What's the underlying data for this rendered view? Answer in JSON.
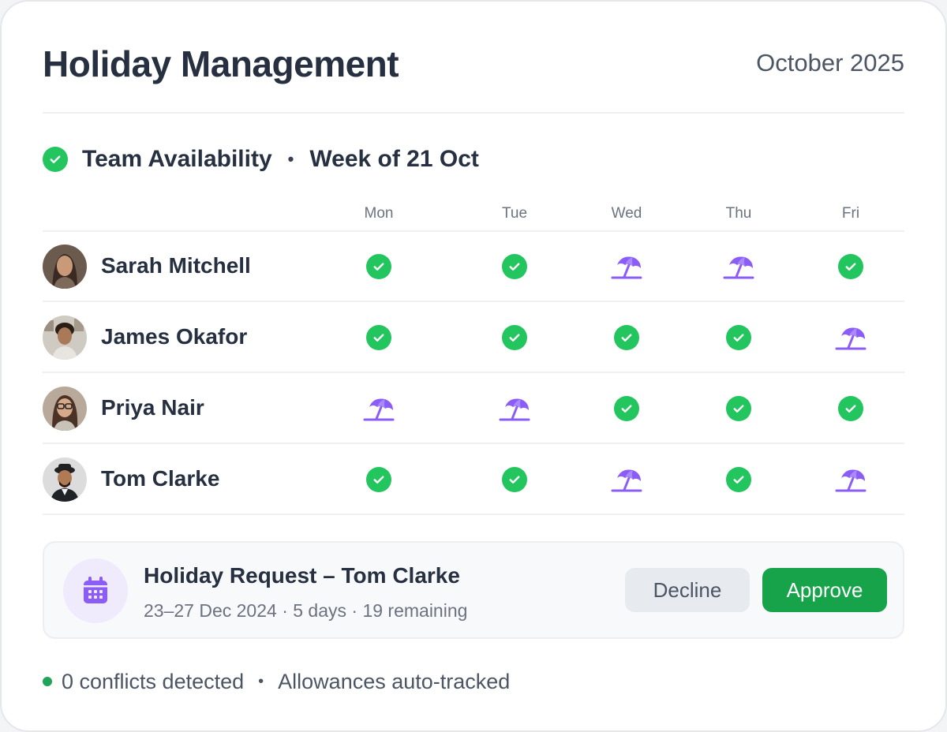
{
  "header": {
    "title": "Holiday Management",
    "month": "October 2025"
  },
  "availability": {
    "heading": "Team Availability",
    "separator": "•",
    "week": "Week of 21 Oct",
    "status_icon": "check-circle-icon",
    "days": [
      "Mon",
      "Tue",
      "Wed",
      "Thu",
      "Fri"
    ],
    "members": [
      {
        "name": "Sarah Mitchell",
        "avatar": "avatar-sarah",
        "days": [
          "available",
          "available",
          "holiday",
          "holiday",
          "available"
        ]
      },
      {
        "name": "James Okafor",
        "avatar": "avatar-james",
        "days": [
          "available",
          "available",
          "available",
          "available",
          "holiday"
        ]
      },
      {
        "name": "Priya Nair",
        "avatar": "avatar-priya",
        "days": [
          "holiday",
          "holiday",
          "available",
          "available",
          "available"
        ]
      },
      {
        "name": "Tom Clarke",
        "avatar": "avatar-tom",
        "days": [
          "available",
          "available",
          "holiday",
          "available",
          "holiday"
        ]
      }
    ]
  },
  "request": {
    "icon": "calendar-icon",
    "title": "Holiday Request – Tom Clarke",
    "details": "23–27 Dec 2024 · 5 days · 19 remaining",
    "decline_label": "Decline",
    "approve_label": "Approve"
  },
  "footer": {
    "conflicts": "0 conflicts detected",
    "separator": "•",
    "allowances": "Allowances auto-tracked"
  },
  "colors": {
    "available": "#22c55e",
    "holiday": "#8b5cf6",
    "approve": "#16a34a",
    "decline_bg": "#e7eaef"
  }
}
